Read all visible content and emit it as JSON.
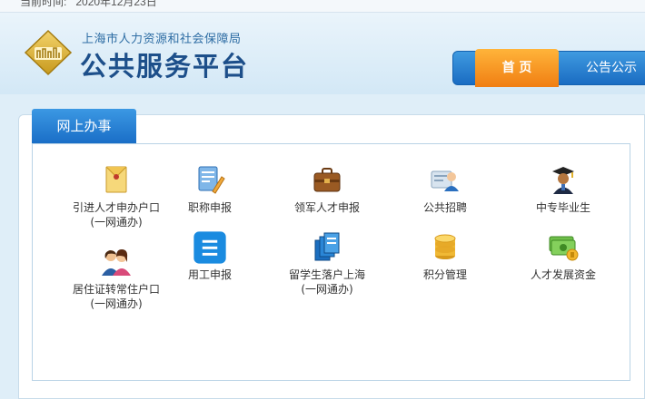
{
  "topbar": {
    "date_label": "当前时间:",
    "date_value": "2020年12月23日"
  },
  "header": {
    "org_name": "上海市人力资源和社会保障局",
    "site_name": "公共服务平台"
  },
  "nav": {
    "items": [
      {
        "label": "首 页",
        "active": true
      },
      {
        "label": "公告公示"
      }
    ]
  },
  "panel": {
    "tab_label": "网上办事",
    "services": [
      {
        "label": "引进人才申办户口",
        "sub": "(一网通办)",
        "icon": "envelope-icon"
      },
      {
        "label": "职称申报",
        "sub": "",
        "icon": "certificate-icon"
      },
      {
        "label": "领军人才申报",
        "sub": "",
        "icon": "briefcase-icon"
      },
      {
        "label": "公共招聘",
        "sub": "",
        "icon": "recruit-icon"
      },
      {
        "label": "中专毕业生",
        "sub": "",
        "icon": "graduate-icon"
      },
      {
        "label": "居住证转常住户口",
        "sub": "(一网通办)",
        "icon": "couple-icon"
      },
      {
        "label": "用工申报",
        "sub": "",
        "icon": "list-icon"
      },
      {
        "label": "留学生落户上海",
        "sub": "(一网通办)",
        "icon": "books-icon"
      },
      {
        "label": "积分管理",
        "sub": "",
        "icon": "coins-icon"
      },
      {
        "label": "人才发展资金",
        "sub": "",
        "icon": "money-icon"
      }
    ]
  },
  "colors": {
    "brand_blue": "#1a6cc2",
    "nav_active": "#f07e12",
    "background": "#dfeef8"
  }
}
